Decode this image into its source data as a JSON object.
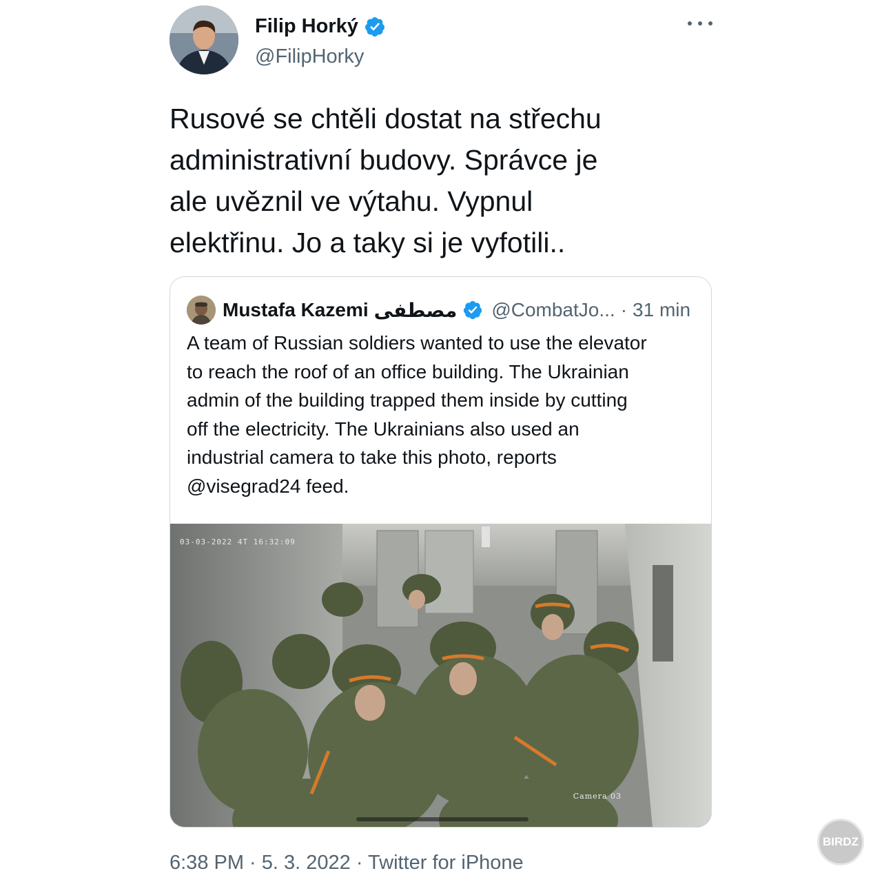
{
  "tweet": {
    "author": {
      "display_name": "Filip Horký",
      "handle": "@FilipHorky",
      "verified": true
    },
    "text": "Rusové se chtěli dostat na střechu\nadministrativní budovy. Správce je\nale uvěznil ve výtahu. Vypnul\nelektřinu. Jo a taky si je vyfotili..",
    "meta": "6:38 PM · 5. 3. 2022 · Twitter for iPhone"
  },
  "quote": {
    "author": {
      "display_name": "Mustafa Kazemi",
      "display_name_arabic": "مصطفى",
      "handle": "@CombatJo...",
      "verified": true
    },
    "separator": "·",
    "time": "31 min",
    "text": "A team of Russian soldiers wanted to use the elevator\nto reach the roof of an office building. The Ukrainian\nadmin of the building trapped them inside by cutting\noff the electricity. The Ukrainians also used an\nindustrial camera to take this photo, reports\n@visegrad24 feed.",
    "media": {
      "timestamp_overlay": "03-03-2022 4T 16:32:09",
      "camera_label": "Camera 03"
    }
  },
  "watermark": "BIRDZ",
  "colors": {
    "verified_blue": "#1d9bf0",
    "text_primary": "#0f1419",
    "text_secondary": "#536471",
    "border": "#cfd9de"
  }
}
